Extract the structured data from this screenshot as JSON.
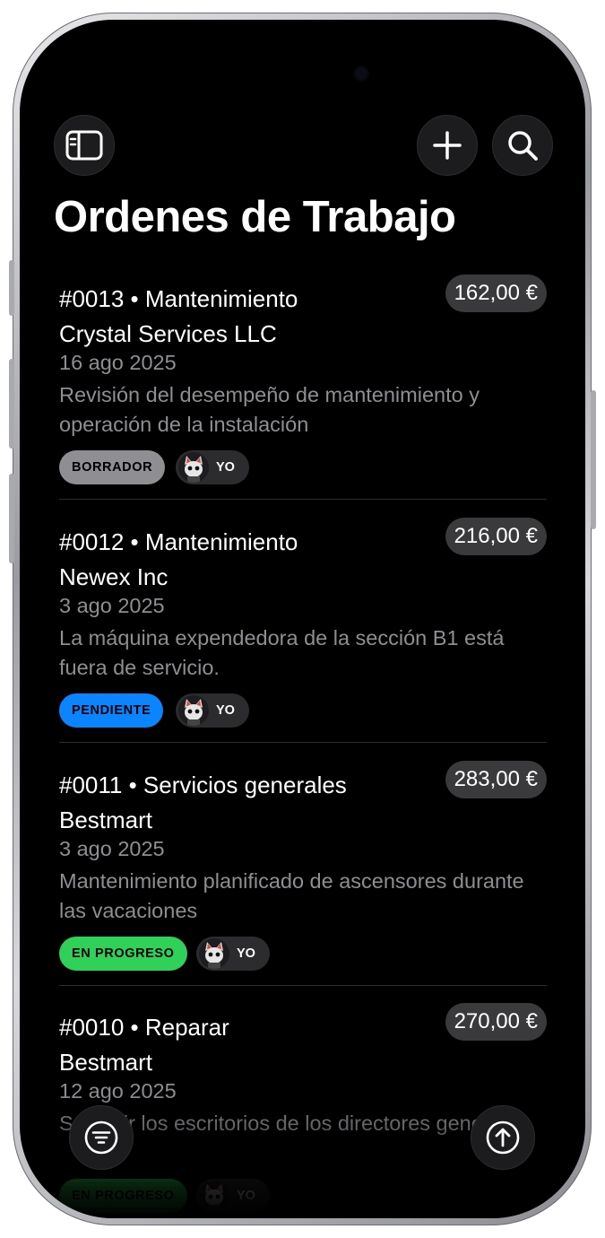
{
  "page": {
    "title": "Ordenes de Trabajo"
  },
  "icons": {
    "sidebar": "sidebar-icon",
    "add": "plus-icon",
    "search": "search-icon",
    "filter": "filter-icon",
    "scroll_top": "arrow-up-circle-icon"
  },
  "colors": {
    "draft": "#8e8e93",
    "pending": "#0a84ff",
    "in_progress": "#30d158",
    "price_bg": "#3a3a3c"
  },
  "orders": [
    {
      "heading": "#0013 • Mantenimiento",
      "client": "Crystal Services LLC",
      "date": "16 ago 2025",
      "description": "Revisión del desempeño de mantenimiento y operación de la instalación",
      "price": "162,00 €",
      "status": "BORRADOR",
      "assignee": "YO"
    },
    {
      "heading": "#0012 • Mantenimiento",
      "client": "Newex Inc",
      "date": "3 ago 2025",
      "description": "La máquina expendedora de la sección B1 está fuera de servicio.",
      "price": "216,00 €",
      "status": "PENDIENTE",
      "assignee": "YO"
    },
    {
      "heading": "#0011 • Servicios generales",
      "client": "Bestmart",
      "date": "3 ago 2025",
      "description": "Mantenimiento planificado de ascensores durante las vacaciones",
      "price": "283,00 €",
      "status": "EN PROGRESO",
      "assignee": "YO"
    },
    {
      "heading": "#0010 • Reparar",
      "client": "Bestmart",
      "date": "12 ago 2025",
      "description": "Sustituir los escritorios de los directores generales",
      "price": "270,00 €",
      "status": "EN PROGRESO",
      "assignee": "YO"
    }
  ]
}
